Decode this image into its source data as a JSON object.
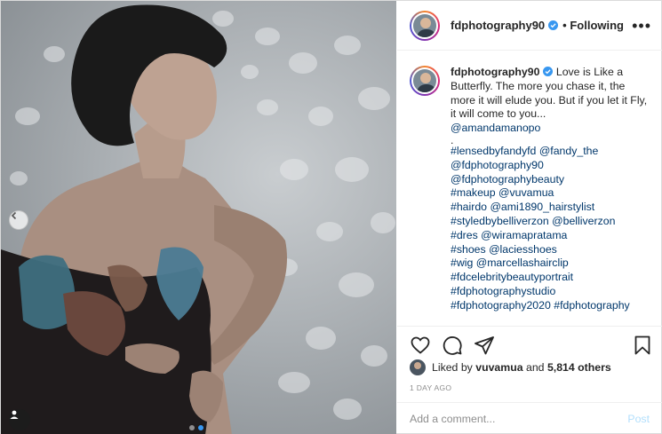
{
  "header": {
    "username": "fdphotography90",
    "follow_state": "• Following",
    "more_icon": "more-horizontal-icon"
  },
  "caption": {
    "username": "fdphotography90",
    "text": "Love is Like a Butterfly. The more you chase it, the more it will elude you. But if you let it Fly, it will come to you...",
    "mention": "@amandamanopo",
    "separator": ".",
    "lines": [
      "#lensedbyfandyfd @fandy_the",
      "@fdphotography90",
      "@fdphotographybeauty",
      "#makeup @vuvamua",
      "#hairdo @ami1890_hairstylist",
      "#styledbybelliverzon @belliverzon",
      "#dres @wiramapratama",
      "#shoes @laciesshoes",
      "#wig @marcellashairclip",
      "#fdcelebritybeautyportrait",
      "#fdphotographystudio",
      "#fdphotography2020 #fdphotography"
    ]
  },
  "likes": {
    "prefix": "Liked by",
    "user": "vuvamua",
    "connector": "and",
    "others": "5,814 others"
  },
  "timestamp": "1 DAY AGO",
  "comment_box": {
    "placeholder": "Add a comment...",
    "post_label": "Post"
  },
  "colors": {
    "link": "#00376b",
    "verified": "#3897f0",
    "post_disabled": "#b2dffc"
  }
}
